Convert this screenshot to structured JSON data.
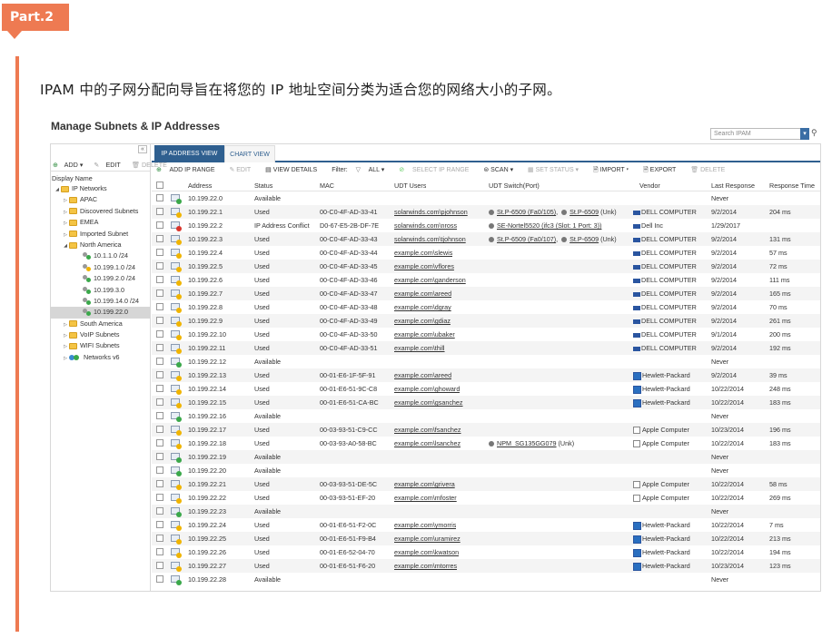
{
  "badge": "Part.2",
  "intro": "IPAM 中的子网分配向导旨在将您的 IP 地址空间分类为适合您的网络大小的子网。",
  "app": {
    "title": "Manage Subnets & IP Addresses",
    "search_placeholder": "Search IPAM",
    "collapse": "«",
    "side_tools": [
      "ADD ▾",
      "EDIT",
      "DELETE"
    ],
    "display_name": "Display Name",
    "tabs": [
      "IP ADDRESS VIEW",
      "CHART VIEW"
    ],
    "toolbar": {
      "add_ip_range": "ADD IP RANGE",
      "edit": "EDIT",
      "view_details": "VIEW DETAILS",
      "filter": "Filter:",
      "all": "ALL ▾",
      "select_ip_range": "SELECT IP RANGE",
      "scan": "SCAN ▾",
      "set_status": "SET STATUS ▾",
      "import": "IMPORT ▾",
      "export": "EXPORT",
      "delete": "DELETE"
    },
    "columns": [
      "Address",
      "Status",
      "MAC",
      "UDT Users",
      "UDT Switch(Port)",
      "Vendor",
      "Last Response",
      "Response Time"
    ]
  },
  "tree": [
    {
      "label": "IP Networks",
      "indent": 0,
      "type": "folder",
      "exp": "open"
    },
    {
      "label": "APAC",
      "indent": 1,
      "type": "folder",
      "exp": "closed"
    },
    {
      "label": "Discovered Subnets",
      "indent": 1,
      "type": "folder",
      "exp": "closed"
    },
    {
      "label": "EMEA",
      "indent": 1,
      "type": "folder",
      "exp": "closed"
    },
    {
      "label": "Imported Subnet",
      "indent": 1,
      "type": "folder",
      "exp": "closed"
    },
    {
      "label": "North America",
      "indent": 1,
      "type": "folder",
      "exp": "open"
    },
    {
      "label": "10.1.1.0 /24",
      "indent": 2,
      "type": "subnet",
      "exp": ""
    },
    {
      "label": "10.199.1.0 /24",
      "indent": 2,
      "type": "subnet-warn",
      "exp": ""
    },
    {
      "label": "10.199.2.0 /24",
      "indent": 2,
      "type": "subnet",
      "exp": ""
    },
    {
      "label": "10.199.3.0",
      "indent": 2,
      "type": "subnet",
      "exp": ""
    },
    {
      "label": "10.199.14.0 /24",
      "indent": 2,
      "type": "subnet",
      "exp": ""
    },
    {
      "label": "10.199.22.0",
      "indent": 2,
      "type": "subnet",
      "exp": "",
      "selected": true
    },
    {
      "label": "South America",
      "indent": 1,
      "type": "folder",
      "exp": "closed"
    },
    {
      "label": "VoIP Subnets",
      "indent": 1,
      "type": "folder",
      "exp": "closed"
    },
    {
      "label": "WIFI Subnets",
      "indent": 1,
      "type": "folder",
      "exp": "closed"
    },
    {
      "label": "Networks v6",
      "indent": 1,
      "type": "v6",
      "exp": "closed"
    }
  ],
  "rows": [
    {
      "addr": "10.199.22.0",
      "status": "Available",
      "mac": "",
      "user": "",
      "switch": [],
      "vendor": "",
      "vlogo": "",
      "last": "Never",
      "rt": "",
      "dot": "#3aa84a"
    },
    {
      "addr": "10.199.22.1",
      "status": "Used",
      "mac": "00-C0-4F-AD-33-41",
      "user": "solarwinds.com\\pjohnson",
      "switch": [
        {
          "u": "St.P-6509 (Fa0/105)",
          "p": ","
        },
        {
          "u": "St.P-6509",
          "p": " (Unk)"
        }
      ],
      "vendor": "DELL COMPUTER",
      "vlogo": "dell",
      "last": "9/2/2014",
      "rt": "204 ms",
      "dot": "#f0b400"
    },
    {
      "addr": "10.199.22.2",
      "status": "IP Address Conflict",
      "mac": "D0-67-E5-2B-DF-7E",
      "user": "solarwinds.com\\nross",
      "switch": [
        {
          "u": "SE-Nortel5520 (ifc3 (Slot: 1 Port: 3))",
          "p": ""
        }
      ],
      "vendor": "Dell Inc",
      "vlogo": "dell",
      "last": "1/29/2017",
      "rt": "",
      "dot": "#d9342b"
    },
    {
      "addr": "10.199.22.3",
      "status": "Used",
      "mac": "00-C0-4F-AD-33-43",
      "user": "solarwinds.com\\tjohnson",
      "switch": [
        {
          "u": "St.P-6509 (Fa0/107)",
          "p": ","
        },
        {
          "u": "St.P-6509",
          "p": " (Unk)"
        }
      ],
      "vendor": "DELL COMPUTER",
      "vlogo": "dell",
      "last": "9/2/2014",
      "rt": "131 ms",
      "dot": "#f0b400"
    },
    {
      "addr": "10.199.22.4",
      "status": "Used",
      "mac": "00-C0-4F-AD-33-44",
      "user": "example.com\\slewis",
      "switch": [],
      "vendor": "DELL COMPUTER",
      "vlogo": "dell",
      "last": "9/2/2014",
      "rt": "57 ms",
      "dot": "#f0b400"
    },
    {
      "addr": "10.199.22.5",
      "status": "Used",
      "mac": "00-C0-4F-AD-33-45",
      "user": "example.com\\vflores",
      "switch": [],
      "vendor": "DELL COMPUTER",
      "vlogo": "dell",
      "last": "9/2/2014",
      "rt": "72 ms",
      "dot": "#f0b400"
    },
    {
      "addr": "10.199.22.6",
      "status": "Used",
      "mac": "00-C0-4F-AD-33-46",
      "user": "example.com\\ganderson",
      "switch": [],
      "vendor": "DELL COMPUTER",
      "vlogo": "dell",
      "last": "9/2/2014",
      "rt": "111 ms",
      "dot": "#f0b400"
    },
    {
      "addr": "10.199.22.7",
      "status": "Used",
      "mac": "00-C0-4F-AD-33-47",
      "user": "example.com\\areed",
      "switch": [],
      "vendor": "DELL COMPUTER",
      "vlogo": "dell",
      "last": "9/2/2014",
      "rt": "165 ms",
      "dot": "#f0b400"
    },
    {
      "addr": "10.199.22.8",
      "status": "Used",
      "mac": "00-C0-4F-AD-33-48",
      "user": "example.com\\dgray",
      "switch": [],
      "vendor": "DELL COMPUTER",
      "vlogo": "dell",
      "last": "9/2/2014",
      "rt": "70 ms",
      "dot": "#f0b400"
    },
    {
      "addr": "10.199.22.9",
      "status": "Used",
      "mac": "00-C0-4F-AD-33-49",
      "user": "example.com\\gdiaz",
      "switch": [],
      "vendor": "DELL COMPUTER",
      "vlogo": "dell",
      "last": "9/2/2014",
      "rt": "261 ms",
      "dot": "#f0b400"
    },
    {
      "addr": "10.199.22.10",
      "status": "Used",
      "mac": "00-C0-4F-AD-33-50",
      "user": "example.com\\ubaker",
      "switch": [],
      "vendor": "DELL COMPUTER",
      "vlogo": "dell",
      "last": "9/1/2014",
      "rt": "200 ms",
      "dot": "#f0b400"
    },
    {
      "addr": "10.199.22.11",
      "status": "Used",
      "mac": "00-C0-4F-AD-33-51",
      "user": "example.com\\thill",
      "switch": [],
      "vendor": "DELL COMPUTER",
      "vlogo": "dell",
      "last": "9/2/2014",
      "rt": "192 ms",
      "dot": "#f0b400"
    },
    {
      "addr": "10.199.22.12",
      "status": "Available",
      "mac": "",
      "user": "",
      "switch": [],
      "vendor": "",
      "vlogo": "",
      "last": "Never",
      "rt": "",
      "dot": "#3aa84a"
    },
    {
      "addr": "10.199.22.13",
      "status": "Used",
      "mac": "00-01-E6-1F-5F-91",
      "user": "example.com\\areed",
      "switch": [],
      "vendor": "Hewlett-Packard",
      "vlogo": "hp",
      "last": "9/2/2014",
      "rt": "39 ms",
      "dot": "#f0b400"
    },
    {
      "addr": "10.199.22.14",
      "status": "Used",
      "mac": "00-01-E6-51-9C-C8",
      "user": "example.com\\ghoward",
      "switch": [],
      "vendor": "Hewlett-Packard",
      "vlogo": "hp",
      "last": "10/22/2014",
      "rt": "248 ms",
      "dot": "#f0b400"
    },
    {
      "addr": "10.199.22.15",
      "status": "Used",
      "mac": "00-01-E6-51-CA-BC",
      "user": "example.com\\gsanchez",
      "switch": [],
      "vendor": "Hewlett-Packard",
      "vlogo": "hp",
      "last": "10/22/2014",
      "rt": "183 ms",
      "dot": "#f0b400"
    },
    {
      "addr": "10.199.22.16",
      "status": "Available",
      "mac": "",
      "user": "",
      "switch": [],
      "vendor": "",
      "vlogo": "",
      "last": "Never",
      "rt": "",
      "dot": "#3aa84a"
    },
    {
      "addr": "10.199.22.17",
      "status": "Used",
      "mac": "00-03-93-51-C9-CC",
      "user": "example.com\\fsanchez",
      "switch": [],
      "vendor": "Apple Computer",
      "vlogo": "apple",
      "last": "10/23/2014",
      "rt": "196 ms",
      "dot": "#f0b400"
    },
    {
      "addr": "10.199.22.18",
      "status": "Used",
      "mac": "00-03-93-A0-58-BC",
      "user": "example.com\\lsanchez",
      "switch": [
        {
          "u": "NPM_SG135GG079",
          "p": " (Unk)"
        }
      ],
      "vendor": "Apple Computer",
      "vlogo": "apple",
      "last": "10/22/2014",
      "rt": "183 ms",
      "dot": "#f0b400"
    },
    {
      "addr": "10.199.22.19",
      "status": "Available",
      "mac": "",
      "user": "",
      "switch": [],
      "vendor": "",
      "vlogo": "",
      "last": "Never",
      "rt": "",
      "dot": "#3aa84a"
    },
    {
      "addr": "10.199.22.20",
      "status": "Available",
      "mac": "",
      "user": "",
      "switch": [],
      "vendor": "",
      "vlogo": "",
      "last": "Never",
      "rt": "",
      "dot": "#3aa84a"
    },
    {
      "addr": "10.199.22.21",
      "status": "Used",
      "mac": "00-03-93-51-DE-5C",
      "user": "example.com\\grivera",
      "switch": [],
      "vendor": "Apple Computer",
      "vlogo": "apple",
      "last": "10/22/2014",
      "rt": "58 ms",
      "dot": "#f0b400"
    },
    {
      "addr": "10.199.22.22",
      "status": "Used",
      "mac": "00-03-93-51-EF-20",
      "user": "example.com\\mfoster",
      "switch": [],
      "vendor": "Apple Computer",
      "vlogo": "apple",
      "last": "10/22/2014",
      "rt": "269 ms",
      "dot": "#f0b400"
    },
    {
      "addr": "10.199.22.23",
      "status": "Available",
      "mac": "",
      "user": "",
      "switch": [],
      "vendor": "",
      "vlogo": "",
      "last": "Never",
      "rt": "",
      "dot": "#3aa84a"
    },
    {
      "addr": "10.199.22.24",
      "status": "Used",
      "mac": "00-01-E6-51-F2-0C",
      "user": "example.com\\ymorris",
      "switch": [],
      "vendor": "Hewlett-Packard",
      "vlogo": "hp",
      "last": "10/22/2014",
      "rt": "7 ms",
      "dot": "#f0b400"
    },
    {
      "addr": "10.199.22.25",
      "status": "Used",
      "mac": "00-01-E6-51-F9-B4",
      "user": "example.com\\uramirez",
      "switch": [],
      "vendor": "Hewlett-Packard",
      "vlogo": "hp",
      "last": "10/22/2014",
      "rt": "213 ms",
      "dot": "#f0b400"
    },
    {
      "addr": "10.199.22.26",
      "status": "Used",
      "mac": "00-01-E6-52-04-70",
      "user": "example.com\\kwatson",
      "switch": [],
      "vendor": "Hewlett-Packard",
      "vlogo": "hp",
      "last": "10/22/2014",
      "rt": "194 ms",
      "dot": "#f0b400"
    },
    {
      "addr": "10.199.22.27",
      "status": "Used",
      "mac": "00-01-E6-51-F6-20",
      "user": "example.com\\mtorres",
      "switch": [],
      "vendor": "Hewlett-Packard",
      "vlogo": "hp",
      "last": "10/23/2014",
      "rt": "123 ms",
      "dot": "#f0b400"
    },
    {
      "addr": "10.199.22.28",
      "status": "Available",
      "mac": "",
      "user": "",
      "switch": [],
      "vendor": "",
      "vlogo": "",
      "last": "Never",
      "rt": "",
      "dot": "#3aa84a"
    }
  ]
}
